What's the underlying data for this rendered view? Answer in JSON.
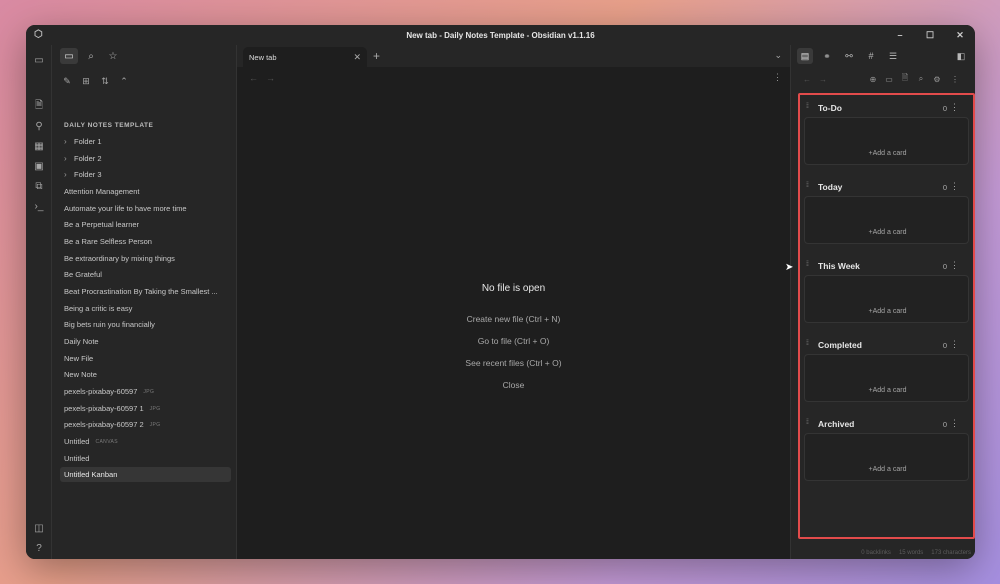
{
  "window": {
    "title": "New tab - Daily Notes Template - Obsidian v1.1.16",
    "controls": [
      "–",
      "☐",
      "✕"
    ]
  },
  "ribbon": {
    "icons": [
      "files-icon",
      "graph-icon",
      "grid-icon",
      "calendar-icon",
      "copy-icon",
      "terminal-icon",
      "vault-icon",
      "help-icon",
      "settings-icon"
    ]
  },
  "sidebar": {
    "vault_name": "DAILY NOTES TEMPLATE",
    "items": [
      {
        "label": "Folder 1",
        "type": "folder"
      },
      {
        "label": "Folder 2",
        "type": "folder"
      },
      {
        "label": "Folder 3",
        "type": "folder"
      },
      {
        "label": "Attention Management",
        "type": "file"
      },
      {
        "label": "Automate your life to have more time",
        "type": "file"
      },
      {
        "label": "Be a Perpetual learner",
        "type": "file"
      },
      {
        "label": "Be a Rare Selfless Person",
        "type": "file"
      },
      {
        "label": "Be extraordinary by mixing things",
        "type": "file"
      },
      {
        "label": "Be Grateful",
        "type": "file"
      },
      {
        "label": "Beat Procrastination By Taking the Smallest ...",
        "type": "file"
      },
      {
        "label": "Being a critic is easy",
        "type": "file"
      },
      {
        "label": "Big bets ruin you financially",
        "type": "file"
      },
      {
        "label": "Daily Note",
        "type": "file"
      },
      {
        "label": "New File",
        "type": "file"
      },
      {
        "label": "New Note",
        "type": "file"
      },
      {
        "label": "pexels-pixabay-60597",
        "type": "file",
        "ext": "JPG"
      },
      {
        "label": "pexels-pixabay-60597 1",
        "type": "file",
        "ext": "JPG"
      },
      {
        "label": "pexels-pixabay-60597 2",
        "type": "file",
        "ext": "JPG"
      },
      {
        "label": "Untitled",
        "type": "file",
        "ext": "CANVAS"
      },
      {
        "label": "Untitled",
        "type": "file"
      },
      {
        "label": "Untitled Kanban",
        "type": "file",
        "selected": true
      }
    ]
  },
  "main": {
    "tab_label": "New tab",
    "empty_title": "No file is open",
    "actions": {
      "create": "Create new file (Ctrl + N)",
      "goto": "Go to file (Ctrl + O)",
      "recent": "See recent files (Ctrl + O)",
      "close": "Close"
    }
  },
  "kanban": {
    "add_card_label": "+Add a card",
    "lanes": [
      {
        "name": "To-Do",
        "count": "0"
      },
      {
        "name": "Today",
        "count": "0"
      },
      {
        "name": "This Week",
        "count": "0"
      },
      {
        "name": "Completed",
        "count": "0"
      },
      {
        "name": "Archived",
        "count": "0"
      }
    ]
  },
  "status": {
    "backlinks": "0 backlinks",
    "words": "15 words",
    "characters": "173 characters"
  },
  "colors": {
    "highlight_border": "#e24b4b",
    "window_bg": "#1e1e1e",
    "panel_bg": "#262626"
  }
}
